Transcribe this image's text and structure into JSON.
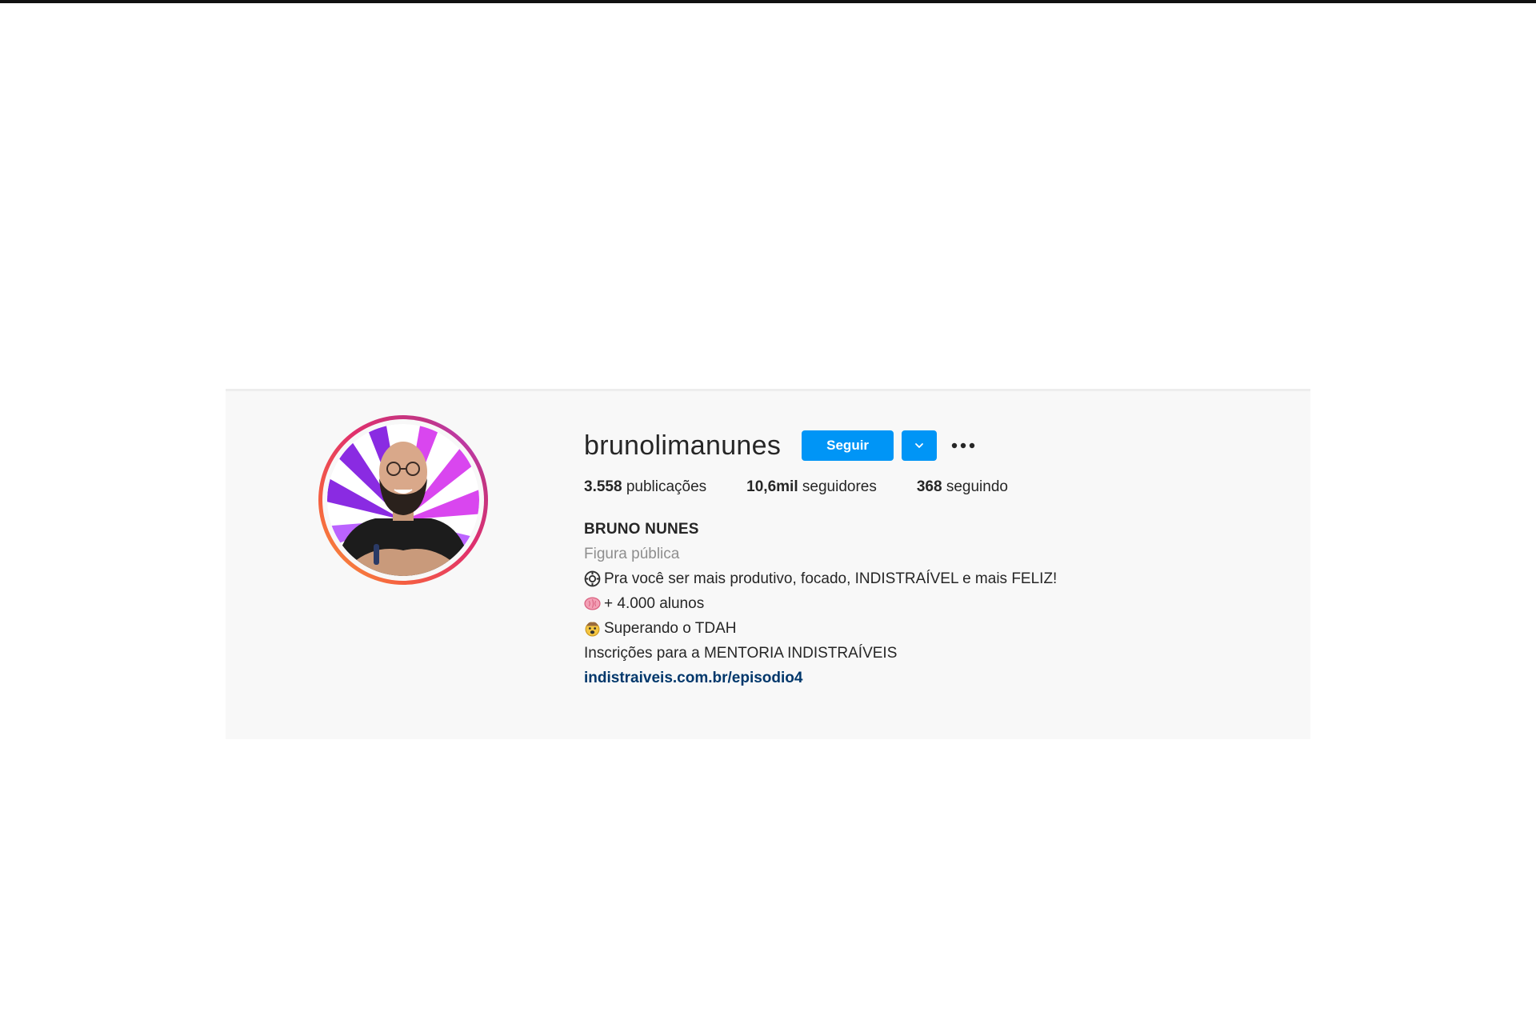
{
  "colors": {
    "accent_blue": "#0095f6",
    "link": "#00376b",
    "text_primary": "#262626",
    "text_secondary": "#8e8e8e",
    "card_background": "#f8f8f8"
  },
  "profile": {
    "username": "brunolimanunes",
    "follow_label": "Seguir",
    "dropdown_icon": "chevron-down-icon",
    "more_icon": "more-options-icon",
    "avatar_icon": "profile-photo"
  },
  "stats": {
    "posts_count": "3.558",
    "posts_label": "publicações",
    "followers_count": "10,6mil",
    "followers_label": "seguidores",
    "following_count": "368",
    "following_label": "seguindo"
  },
  "bio": {
    "full_name": "BRUNO NUNES",
    "category": "Figura pública",
    "line1_icon": "gear-icon",
    "line1": "Pra você ser mais produtivo, focado, INDISTRAÍVEL e mais FELIZ!",
    "line2_icon": "brain-icon",
    "line2": "+ 4.000 alunos",
    "line3_icon": "mind-blown-icon",
    "line3": "Superando o TDAH",
    "line4": "Inscrições para a MENTORIA INDISTRAÍVEIS",
    "link": "indistraiveis.com.br/episodio4"
  }
}
